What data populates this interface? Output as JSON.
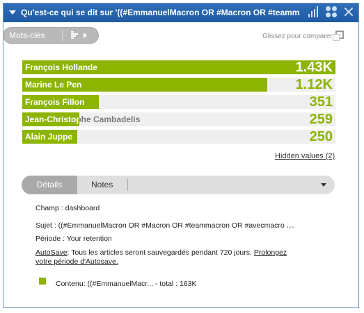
{
  "window": {
    "title": "Qu'est-ce qui se dit sur '((#EmmanuelMacron OR #Macron OR #teamm"
  },
  "toolbar": {
    "keywords_label": "Mots-clés",
    "compare_hint": "Glissez pour comparer"
  },
  "chart_data": {
    "type": "bar",
    "categories": [
      "François Hollande",
      "Marine Le Pen",
      "François Fillon",
      "Jean-Christophe Cambadelis",
      "Alain Juppe"
    ],
    "values": [
      1430,
      1120,
      351,
      259,
      250
    ],
    "value_labels": [
      "1.43K",
      "1.12K",
      "351",
      "259",
      "250"
    ]
  },
  "hidden_values": "Hidden values (2)",
  "tabs": {
    "details": "Détails",
    "notes": "Notes"
  },
  "details": {
    "champ": "Champ : dashboard",
    "sujet": "Sujet : ((#EmmanuelMacron OR #Macron OR #teammacron OR #avecmacro",
    "sujet_more": "...",
    "periode": "Période : Your retention",
    "autosave_label": "AutoSave",
    "autosave_text": ": Tous les articles seront sauvegardés pendant 720 jours. ",
    "autosave_link1": "Prolongez",
    "autosave_link2": "votre période d'Autosave.",
    "legend": "Contenu: ((#EmmanuelMacr...   - total : 163K"
  },
  "colors": {
    "accent": "#8db400",
    "titlebar": "#2467b1"
  }
}
